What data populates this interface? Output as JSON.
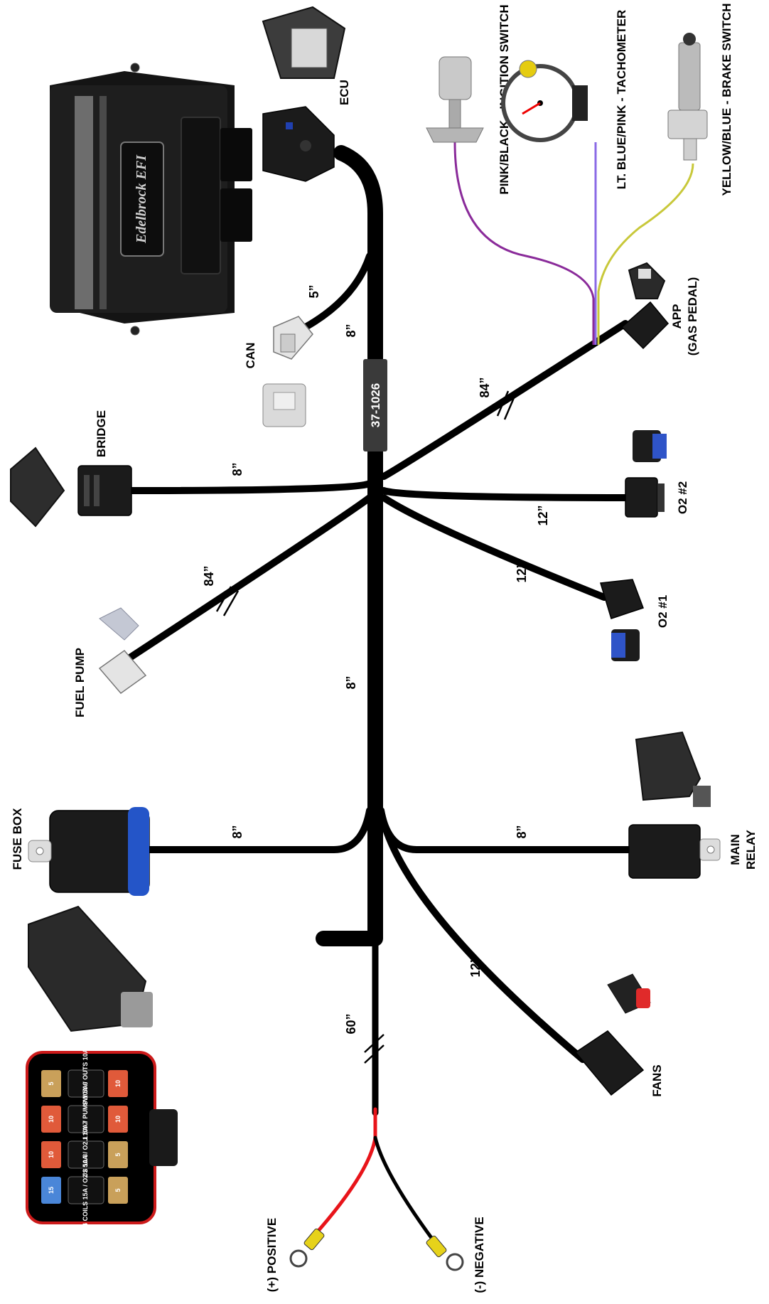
{
  "part_number": "37-1026",
  "ecu_brand_logo": "Edelbrock EFI",
  "connectors": {
    "ecu": "ECU",
    "can": "CAN",
    "bridge": "BRIDGE",
    "fuel_pump": "FUEL PUMP",
    "fuse_box": "FUSE BOX",
    "positive": "(+) POSITIVE",
    "negative": "(-) NEGATIVE",
    "fans": "FANS",
    "main_relay_1": "MAIN",
    "main_relay_2": "RELAY",
    "o2_1": "O2 #1",
    "o2_2": "O2 #2",
    "app_1": "APP",
    "app_2": "(GAS PEDAL)",
    "ignition": "PINK/BLACK - INGITION SWITCH",
    "tach": "LT. BLUE/PINK - TACHOMETER",
    "brake": "YELLOW/BLUE - BRAKE SWITCH"
  },
  "lengths": {
    "can": "5”",
    "main_upper": "8”",
    "bridge": "8”",
    "app": "84”",
    "o2_2": "12”",
    "o2_1": "12”",
    "fuel_pump": "84”",
    "main_lower": "8”",
    "fuse_box": "8”",
    "main_relay": "8”",
    "fans": "12”",
    "battery": "60”"
  },
  "fuse_box_labels": [
    {
      "num_left": "1",
      "text": "IGN SW 5A / OUTS 10A",
      "num_right": "5"
    },
    {
      "num_left": "2",
      "text": "ECU 10A / PUMP 10A",
      "num_right": "6"
    },
    {
      "num_left": "3",
      "text": "INJS 10A / O2 1 5A",
      "num_right": "7"
    },
    {
      "num_left": "4",
      "text": "COILS 15A / O2 2 5A",
      "num_right": "8"
    }
  ],
  "fuses_top": [
    "10",
    "10",
    "5",
    "5"
  ],
  "fuses_bottom": [
    "5",
    "10",
    "10",
    "15"
  ],
  "colors": {
    "wire": "#000000",
    "positive": "#e8141a",
    "ignition_wire": "#8a2b9a",
    "tach_wire": "#8a6ae6",
    "brake_wire": "#c8c83a",
    "fuse_box_blue": "#2455c8",
    "o2_blue": "#2f54c8",
    "fuse_red": "#e05a3a",
    "fuse_tan": "#c9a05a",
    "fuse_blue": "#4a86d8",
    "ring_terminal": "#e6d21a"
  }
}
